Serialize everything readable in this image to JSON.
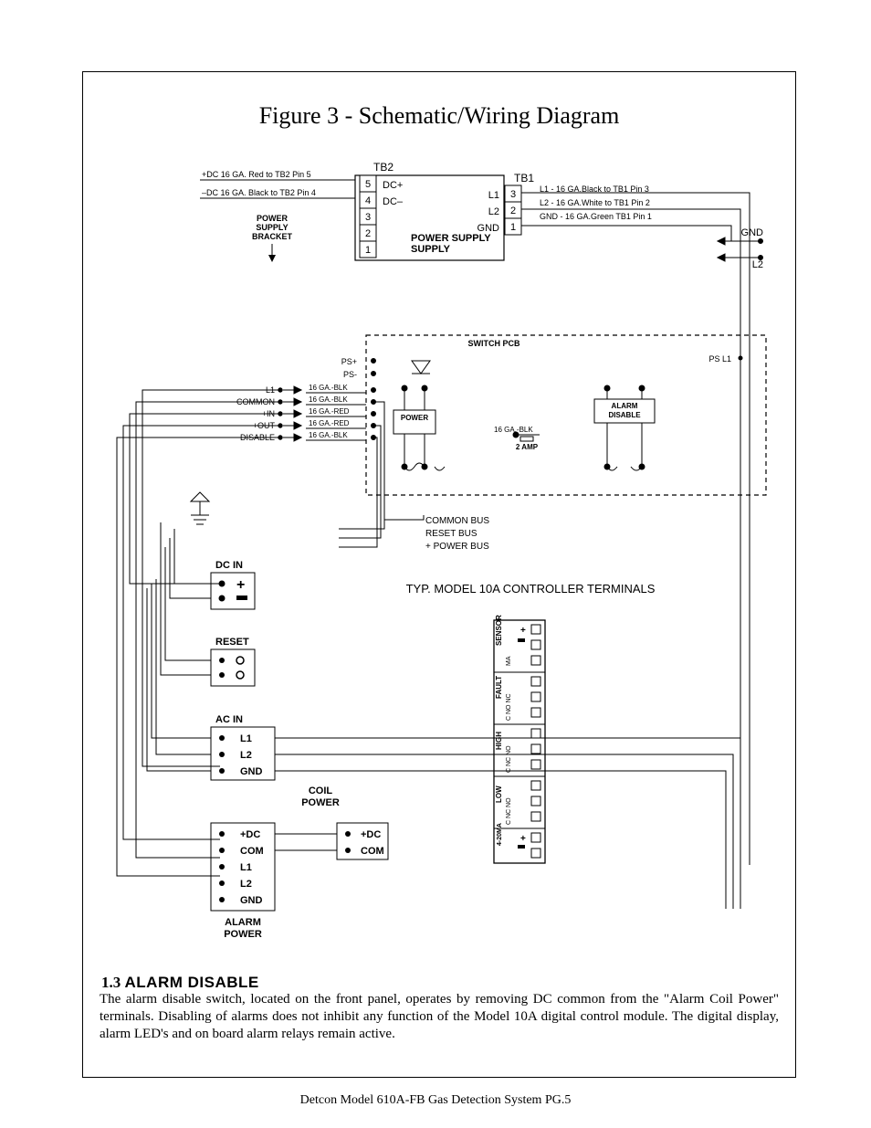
{
  "figure_title": "Figure 3 - Schematic/Wiring Diagram",
  "footer": "Detcon Model 610A-FB Gas Detection System    PG.5",
  "section": {
    "num": "1.3",
    "title": "ALARM DISABLE"
  },
  "body": "The alarm disable switch, located on the front panel, operates by removing DC common from the \"Alarm Coil Power\" terminals. Disabling of alarms does not inhibit any function of the Model 10A digital control module. The digital display, alarm LED's and on board alarm relays remain active.",
  "labels": {
    "tb2": "TB2",
    "tb1": "TB1",
    "dcp": "DC+",
    "dcm": "DC–",
    "gnd": "GND",
    "l1": "L1",
    "l2": "L2",
    "power_supply": "POWER\nSUPPLY",
    "ps_bracket": "POWER\nSUPPLY\nBRACKET",
    "wire_dc_pos": "+DC 16 GA. Red to TB2 Pin 5",
    "wire_dc_neg": "–DC 16 GA. Black to TB2 Pin 4",
    "wire_l1": "L1 - 16 GA.Black to TB1 Pin 3",
    "wire_l2": "L2 - 16 GA.White to TB1 Pin 2",
    "wire_gnd": "GND - 16 GA.Green TB1 Pin 1",
    "switch_pcb": "SWITCH PCB",
    "ps_l1": "PS L1",
    "ps_plus": "PS+",
    "ps_minus": "PS-",
    "power": "POWER",
    "alarm_disable": "ALARM\nDISABLE",
    "amp": "2 AMP",
    "ga_blk": "16 GA.-BLK",
    "ga_red": "16 GA.-RED",
    "left_terms": [
      "L1",
      "COMMON",
      "+IN",
      "+OUT",
      "DISABLE"
    ],
    "bus": [
      "COMMON BUS",
      "RESET BUS",
      "+ POWER BUS"
    ],
    "dc_in": "DC IN",
    "reset": "RESET",
    "ac_in": "AC IN",
    "coil_power": "COIL\nPOWER",
    "alarm_power": "ALARM\nPOWER",
    "model": "TYP. MODEL 10A CONTROLLER TERMINALS",
    "dc": "+DC",
    "com": "COM",
    "vert_groups": [
      "SENSOR",
      "FAULT",
      "HIGH",
      "LOW",
      "4-20MA"
    ],
    "vert_sub": {
      "sensor": "+  MA –",
      "fault": "C NO NC",
      "high": "C  NC NO",
      "low": "C  NC NO",
      "ma": "+    –"
    }
  },
  "tb2_pins": [
    5,
    4,
    3,
    2,
    1
  ],
  "tb1_pins": [
    3,
    2,
    1
  ],
  "ac_rows": [
    "L1",
    "L2",
    "GND"
  ],
  "alarm_rows": [
    "+DC",
    "COM",
    "L1",
    "L2",
    "GND"
  ]
}
